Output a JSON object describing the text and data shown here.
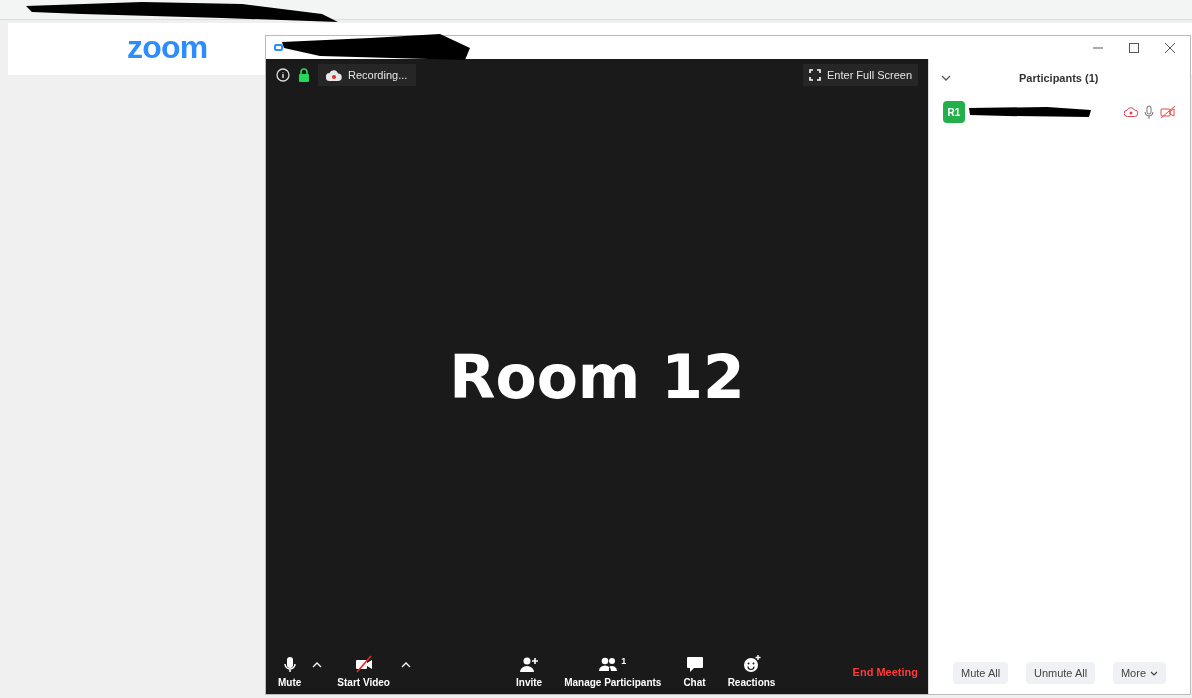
{
  "app_logo": "zoom",
  "meeting": {
    "recording_label": "Recording...",
    "full_screen_button": "Enter Full Screen",
    "room_label": "Room 12"
  },
  "toolbar": {
    "items": [
      {
        "kind": "mic",
        "label": "Mute",
        "has_menu": true
      },
      {
        "kind": "video",
        "label": "Start Video",
        "has_menu": true
      },
      {
        "kind": "invite",
        "label": "Invite",
        "has_menu": false
      },
      {
        "kind": "participants",
        "label": "Manage Participants",
        "has_menu": false,
        "count": "1"
      },
      {
        "kind": "chat",
        "label": "Chat",
        "has_menu": false
      },
      {
        "kind": "reactions",
        "label": "Reactions",
        "has_menu": false
      }
    ],
    "end_button": "End Meeting"
  },
  "participants_panel": {
    "title": "Participants (1)",
    "participants": [
      {
        "initials": "R1",
        "muted": false,
        "video_on": false
      }
    ],
    "buttons": [
      "Mute All",
      "Unmute All",
      "More"
    ]
  }
}
